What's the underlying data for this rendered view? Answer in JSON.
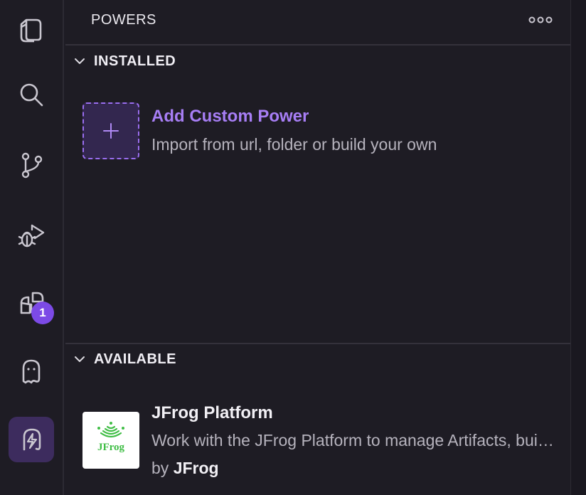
{
  "activity_bar": {
    "items": [
      {
        "icon": "files-icon"
      },
      {
        "icon": "search-icon"
      },
      {
        "icon": "source-control-icon"
      },
      {
        "icon": "run-debug-icon"
      },
      {
        "icon": "extensions-icon",
        "badge": "1"
      },
      {
        "icon": "ghost-icon"
      },
      {
        "icon": "powers-icon",
        "active": true
      }
    ],
    "accent": "#7c4ae6"
  },
  "panel": {
    "title": "POWERS",
    "more_icon": "more-icon"
  },
  "installed": {
    "header": "INSTALLED",
    "custom_power": {
      "title": "Add Custom Power",
      "description": "Import from url, folder or build your own"
    }
  },
  "available": {
    "header": "AVAILABLE",
    "items": [
      {
        "title": "JFrog Platform",
        "description": "Work with the JFrog Platform to manage Artifacts, builds and releases",
        "by_prefix": "by",
        "author": "JFrog",
        "logo_text": "JFrog",
        "logo_color": "#40be46"
      }
    ]
  }
}
